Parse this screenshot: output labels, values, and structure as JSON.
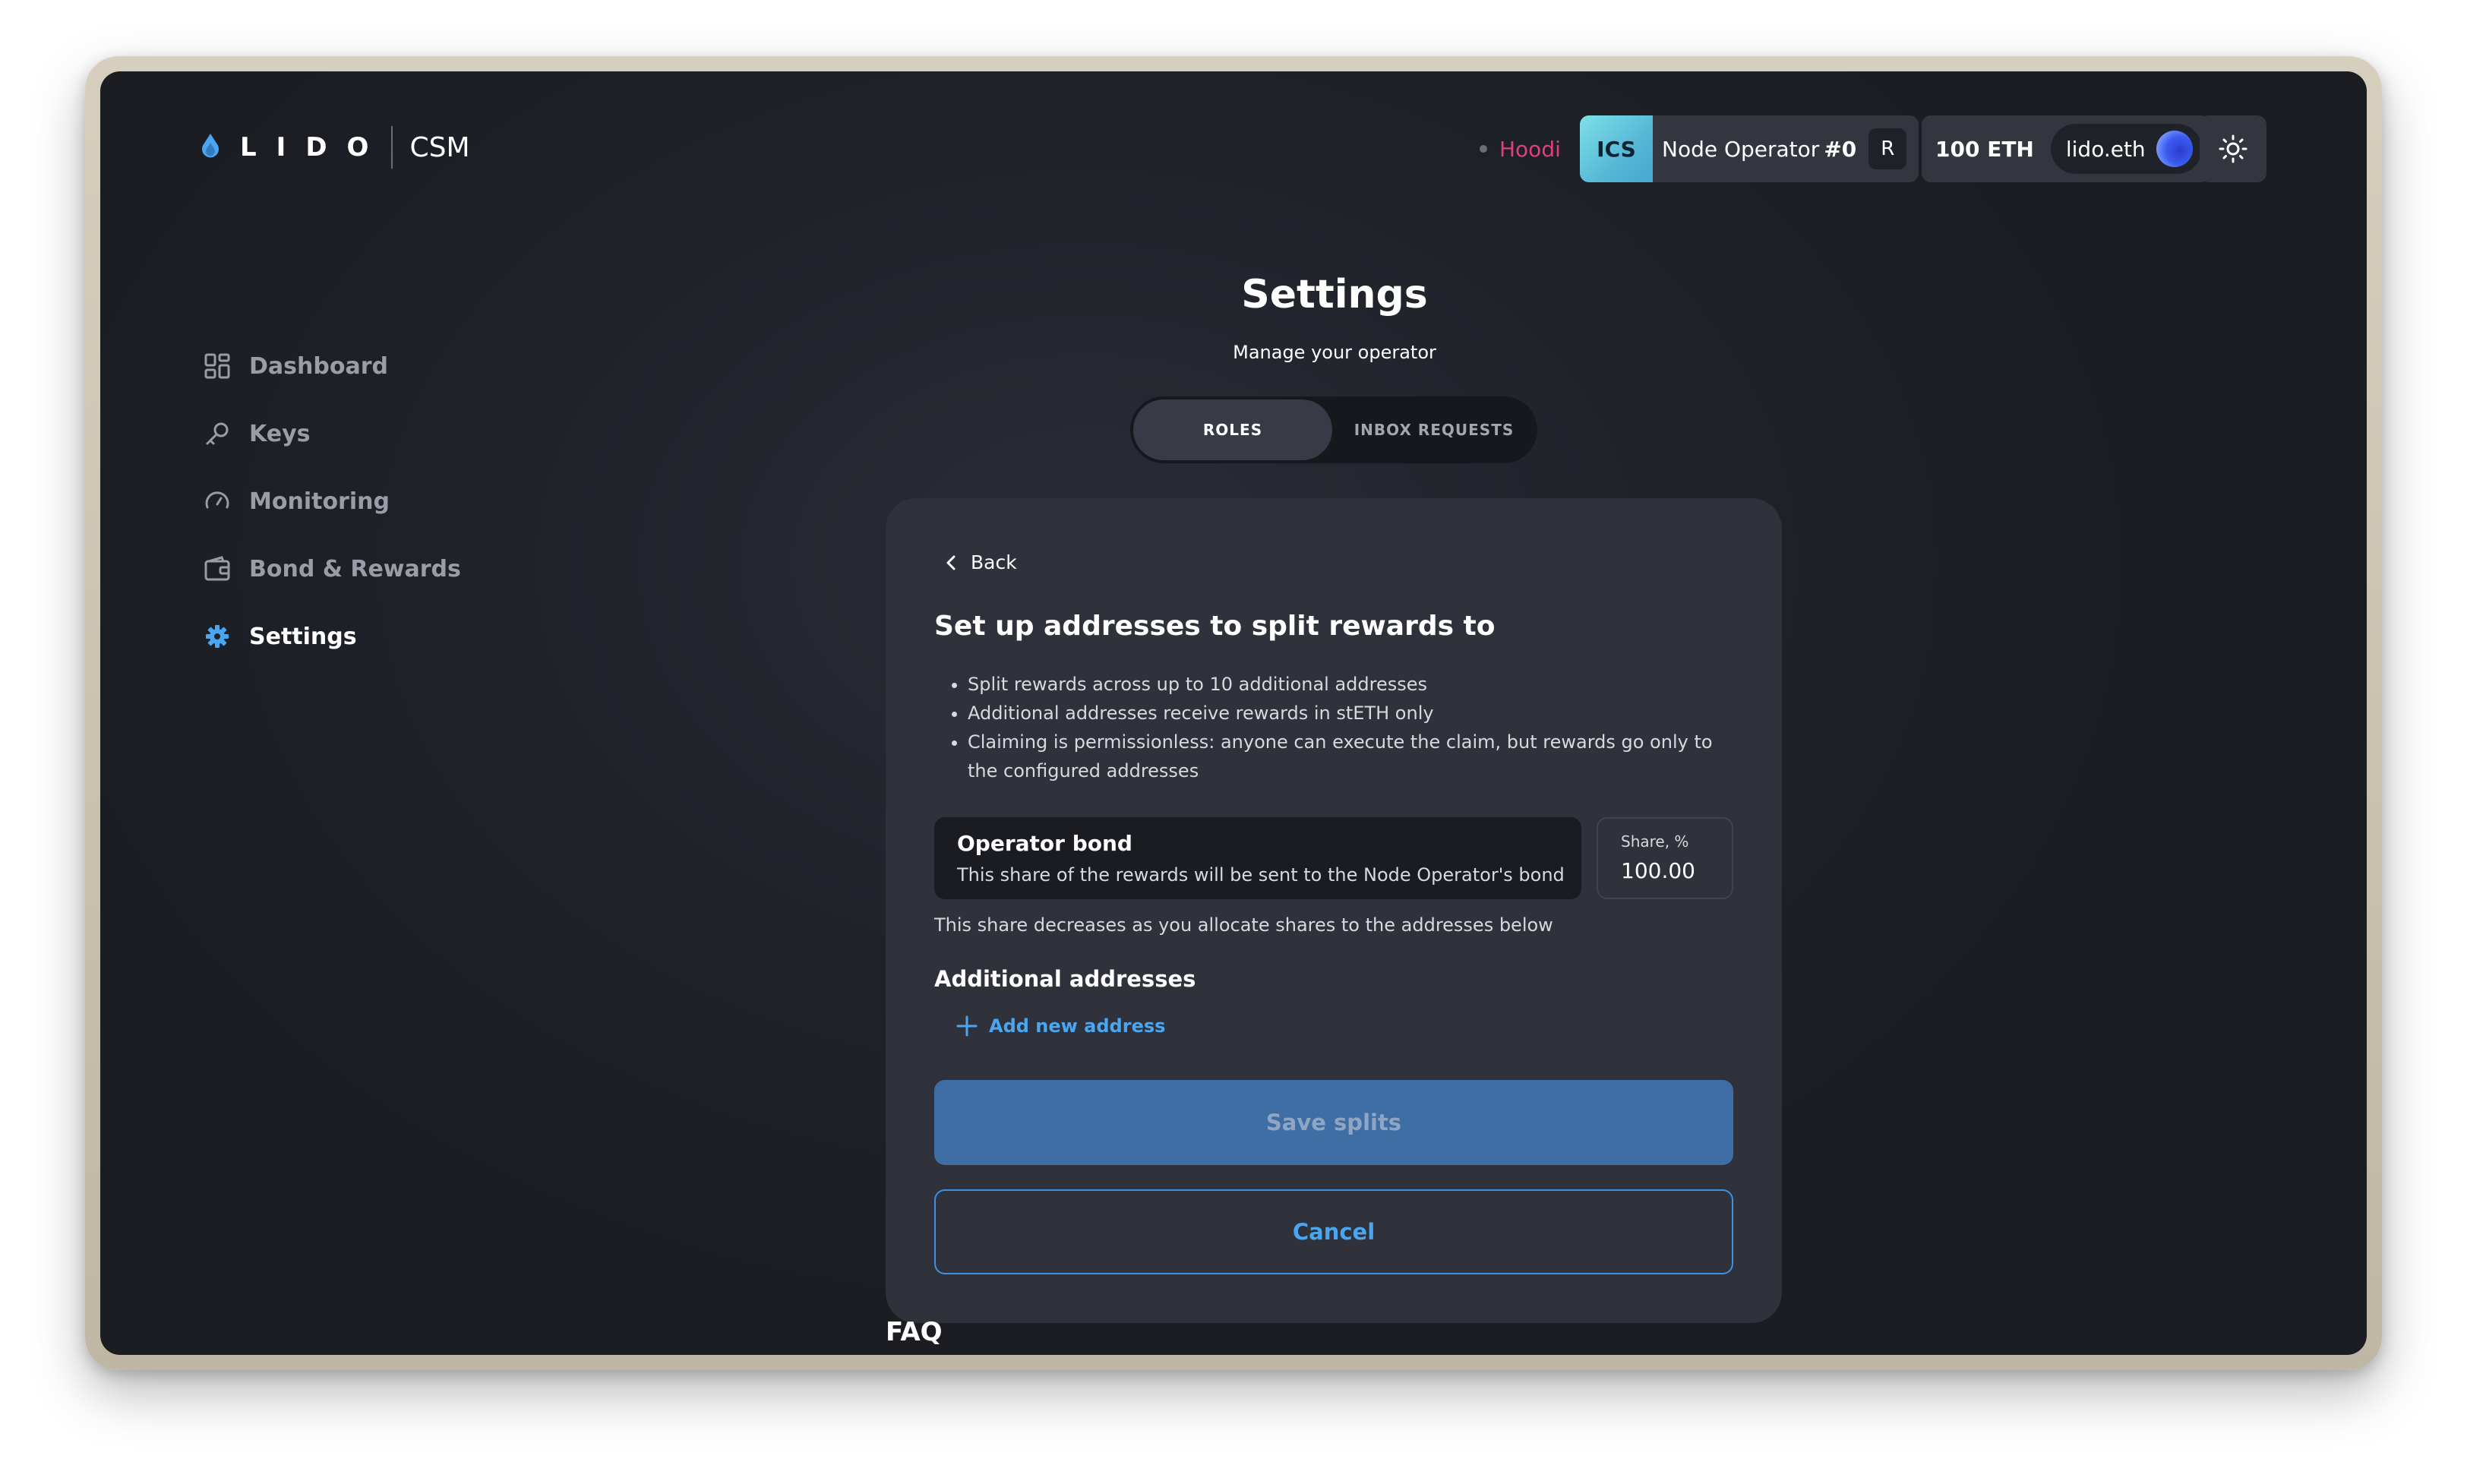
{
  "header": {
    "logo_text": "LIDO",
    "product": "CSM",
    "network": "Hoodi",
    "operator_type": "ICS",
    "operator_name": "Node Operator",
    "operator_number": "#0",
    "role_badge": "R",
    "balance": "100 ETH",
    "ens_name": "lido.eth",
    "theme_icon": "sun-icon"
  },
  "sidebar": {
    "items": [
      {
        "label": "Dashboard",
        "icon": "dashboard-icon"
      },
      {
        "label": "Keys",
        "icon": "key-icon"
      },
      {
        "label": "Monitoring",
        "icon": "gauge-icon"
      },
      {
        "label": "Bond & Rewards",
        "icon": "wallet-icon"
      },
      {
        "label": "Settings",
        "icon": "gear-icon",
        "active": true
      }
    ]
  },
  "page": {
    "title": "Settings",
    "subtitle": "Manage your operator",
    "tabs": [
      {
        "label": "ROLES",
        "active": true
      },
      {
        "label": "INBOX REQUESTS",
        "active": false
      }
    ]
  },
  "card": {
    "back_label": "Back",
    "title": "Set up addresses to split rewards to",
    "bullets": [
      "Split rewards across up to 10 additional addresses",
      "Additional addresses receive rewards in stETH only",
      "Claiming is permissionless: anyone can execute the claim, but rewards go only to the configured addresses"
    ],
    "bond": {
      "title": "Operator bond",
      "description": "This share of the rewards will be sent to the Node Operator's bond"
    },
    "share": {
      "label": "Share, %",
      "value": "100.00"
    },
    "hint": "This share decreases as you allocate shares to the addresses below",
    "additional_title": "Additional addresses",
    "add_label": "Add new address",
    "save_label": "Save splits",
    "cancel_label": "Cancel"
  },
  "faq_title": "FAQ",
  "colors": {
    "accent": "#4aa6f0",
    "network": "#e0407a",
    "save_bg": "#3f6ea4",
    "card_bg": "#30323b"
  }
}
